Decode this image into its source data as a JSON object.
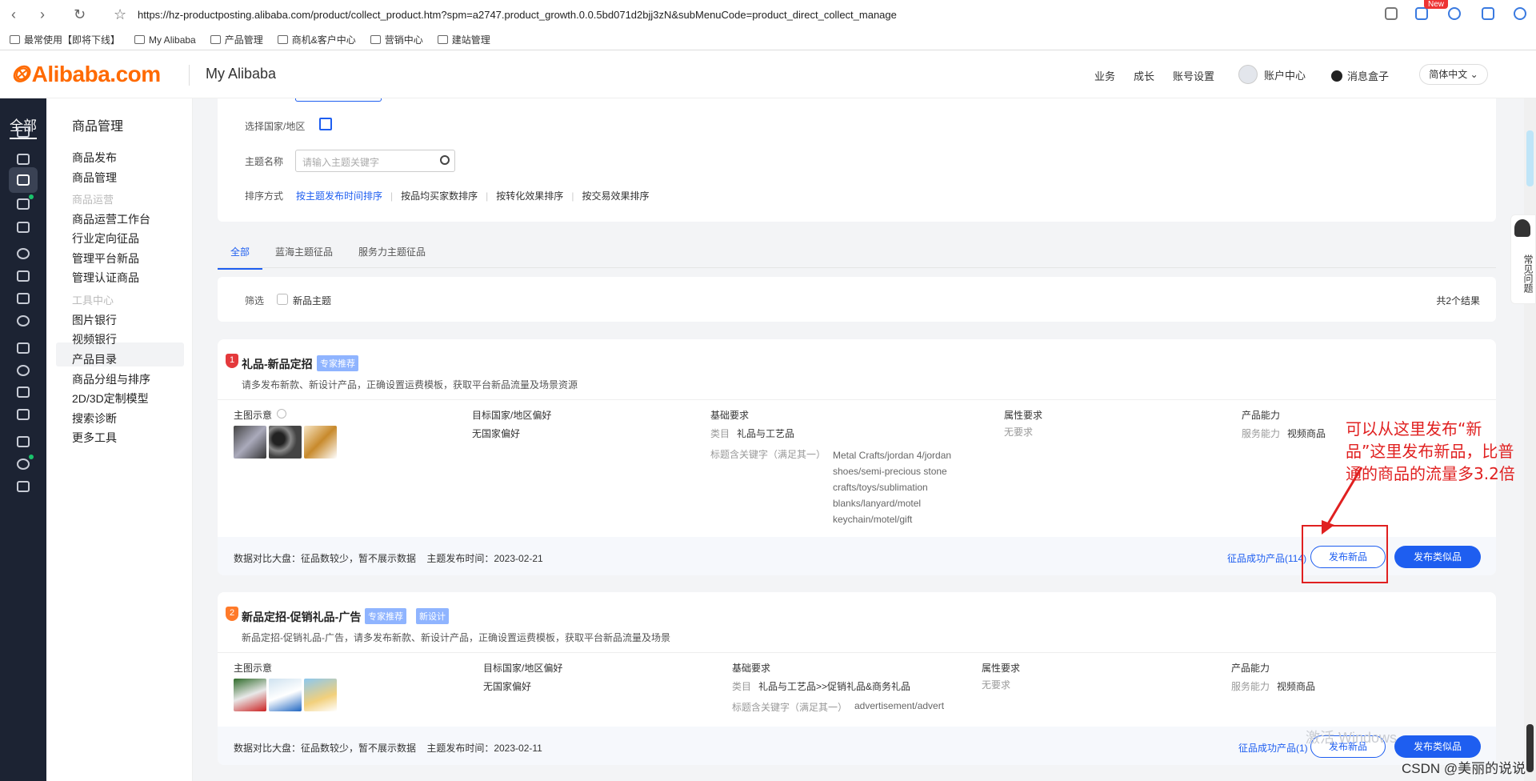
{
  "browser": {
    "url": "https://hz-productposting.alibaba.com/product/collect_product.htm?spm=a2747.product_growth.0.0.5bd071d2bjj3zN&subMenuCode=product_direct_collect_manage",
    "new_badge": "New",
    "bookmarks": [
      "最常使用【即将下线】",
      "My Alibaba",
      "产品管理",
      "商机&客户中心",
      "营销中心",
      "建站管理"
    ]
  },
  "header": {
    "logo": "Alibaba.com",
    "section": "My Alibaba",
    "nav": [
      "业务",
      "成长",
      "账号设置"
    ],
    "account": "账户中心",
    "messages": "消息盒子",
    "language": "简体中文"
  },
  "leftbar": {
    "all_label": "全部"
  },
  "submenu": {
    "title": "商品管理",
    "items_top": [
      "商品发布",
      "商品管理"
    ],
    "group1": "商品运营",
    "items_mid": [
      "商品运营工作台",
      "行业定向征品",
      "管理平台新品",
      "管理认证商品"
    ],
    "group2": "工具中心",
    "items_tools": [
      "图片银行",
      "视频银行",
      "产品目录",
      "商品分组与排序",
      "2D/3D定制模型",
      "搜索诊断",
      "更多工具"
    ]
  },
  "filter": {
    "country_label": "选择国家/地区",
    "topic_label": "主题名称",
    "search_placeholder": "请输入主题关键字",
    "sort_label": "排序方式",
    "sort_options": [
      "按主题发布时间排序",
      "按品均买家数排序",
      "按转化效果排序",
      "按交易效果排序"
    ]
  },
  "tabs": [
    "全部",
    "蓝海主题征品",
    "服务力主题征品"
  ],
  "screen": {
    "label": "筛选",
    "checkbox": "新品主题",
    "result": "共2个结果"
  },
  "cards": [
    {
      "rank": "1",
      "title": "礼品-新品定招",
      "tags": [
        "专家推荐"
      ],
      "desc": "请多发布新款、新设计产品，正确设置运费模板，获取平台新品流量及场景资源",
      "image_label": "主图示意",
      "target_label": "目标国家/地区偏好",
      "target_value": "无国家偏好",
      "basic_label": "基础要求",
      "category_label": "类目",
      "category_value": "礼品与工艺品",
      "keyword_label": "标题含关键字（满足其一）",
      "keywords": [
        "Metal Crafts/jordan 4/jordan",
        "shoes/semi-precious stone",
        "crafts/toys/sublimation",
        "blanks/lanyard/motel",
        "keychain/motel/gift"
      ],
      "attr_label": "属性要求",
      "attr_value": "无要求",
      "ability_label": "产品能力",
      "ability_key": "服务能力",
      "ability_value": "视频商品",
      "footer_text": "数据对比大盘：征品数较少，暂不展示数据    主题发布时间：2023-02-21",
      "success_link": "征品成功产品(114)",
      "btn_new": "发布新品",
      "btn_similar": "发布类似品"
    },
    {
      "rank": "2",
      "title": "新品定招-促销礼品-广告",
      "tags": [
        "专家推荐",
        "新设计"
      ],
      "desc": "新品定招-促销礼品-广告，请多发布新款、新设计产品，正确设置运费模板，获取平台新品流量及场景",
      "image_label": "主图示意",
      "target_label": "目标国家/地区偏好",
      "target_value": "无国家偏好",
      "basic_label": "基础要求",
      "category_label": "类目",
      "category_value": "礼品与工艺品>>促销礼品&商务礼品",
      "keyword_label": "标题含关键字（满足其一）",
      "keywords": [
        "advertisement/advert"
      ],
      "attr_label": "属性要求",
      "attr_value": "无要求",
      "ability_label": "产品能力",
      "ability_key": "服务能力",
      "ability_value": "视频商品",
      "footer_text": "数据对比大盘：征品数较少，暂不展示数据    主题发布时间：2023-02-11",
      "success_link": "征品成功产品(1)",
      "btn_new": "发布新品",
      "btn_similar": "发布类似品"
    }
  ],
  "annotation": {
    "text": "可以从这里发布“新品”这里发布新品，比普通的商品的流量多3.2倍"
  },
  "faq": "常见问题",
  "overlay": {
    "windows": "激活 Windows",
    "watermark": "CSDN @美丽的说说"
  },
  "colors": {
    "brand": "#ff6a00",
    "link": "#1e5ef0",
    "annotation": "#e02020",
    "sidebar": "#1c2333"
  }
}
